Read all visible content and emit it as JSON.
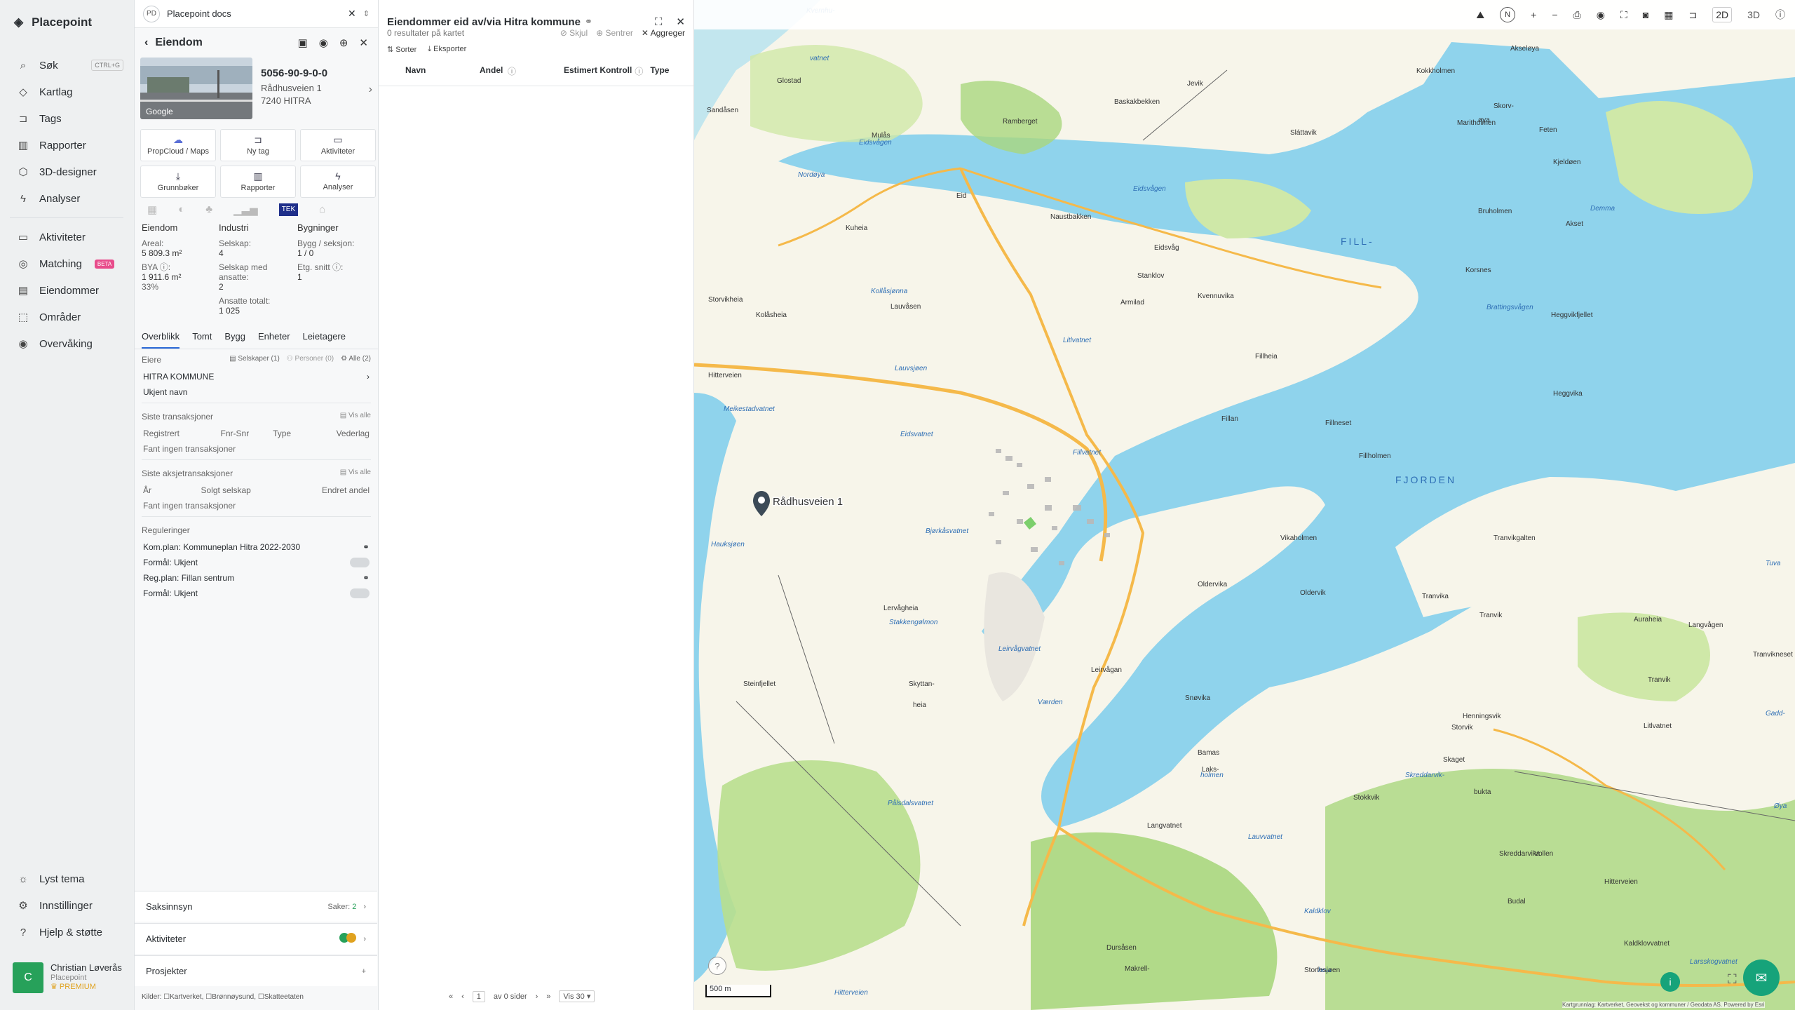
{
  "nav": {
    "brand": "Placepoint",
    "items": [
      {
        "label": "Søk",
        "icon": "search-icon",
        "kbd": "CTRL+G"
      },
      {
        "label": "Kartlag",
        "icon": "layers-icon"
      },
      {
        "label": "Tags",
        "icon": "bookmark-icon"
      },
      {
        "label": "Rapporter",
        "icon": "chart-icon"
      },
      {
        "label": "3D-designer",
        "icon": "cube-icon"
      },
      {
        "label": "Analyser",
        "icon": "bolt-icon"
      }
    ],
    "items2": [
      {
        "label": "Aktiviteter",
        "icon": "chat-icon"
      },
      {
        "label": "Matching",
        "icon": "target-icon",
        "badge": "BETA"
      },
      {
        "label": "Eiendommer",
        "icon": "building-icon"
      },
      {
        "label": "Områder",
        "icon": "area-icon"
      },
      {
        "label": "Overvåking",
        "icon": "bell-icon"
      }
    ],
    "bottom": [
      {
        "label": "Lyst tema",
        "icon": "sun-icon"
      },
      {
        "label": "Innstillinger",
        "icon": "gear-icon"
      },
      {
        "label": "Hjelp & støtte",
        "icon": "help-icon"
      }
    ],
    "user": {
      "initial": "C",
      "name": "Christian Løverås",
      "org": "Placepoint",
      "plan": "PREMIUM"
    }
  },
  "panel1": {
    "tab": {
      "pd": "PD",
      "title": "Placepoint docs"
    },
    "title": "Eiendom",
    "property": {
      "id": "5056-90-9-0-0",
      "street": "Rådhusveien 1",
      "postal": "7240 HITRA",
      "photo_credit": "Google"
    },
    "actions": [
      {
        "label": "PropCloud / Maps",
        "icon": "cloud-icon"
      },
      {
        "label": "Ny tag",
        "icon": "bookmark-icon"
      },
      {
        "label": "Aktiviteter",
        "icon": "chat-icon"
      },
      {
        "label": "Grunnbøker",
        "icon": "download-icon"
      },
      {
        "label": "Rapporter",
        "icon": "chart-icon"
      },
      {
        "label": "Analyser",
        "icon": "bolt-icon"
      }
    ],
    "tek_logo": "TEK",
    "stats": {
      "eiendom": {
        "head": "Eiendom",
        "areal_label": "Areal:",
        "areal": "5 809.3 m²",
        "bya_label": "BYA ⓘ:",
        "bya": "1 911.6 m²",
        "bya_pct": "33%"
      },
      "industri": {
        "head": "Industri",
        "selskap_label": "Selskap:",
        "selskap": "4",
        "ansatte_label": "Selskap med ansatte:",
        "ansatte": "2",
        "totalt_label": "Ansatte totalt:",
        "totalt": "1 025"
      },
      "bygninger": {
        "head": "Bygninger",
        "bygg_label": "Bygg / seksjon:",
        "bygg": "1 / 0",
        "etg_label": "Etg. snitt ⓘ:",
        "etg": "1"
      }
    },
    "tabs": [
      "Overblikk",
      "Tomt",
      "Bygg",
      "Enheter",
      "Leietagere"
    ],
    "eiere": {
      "label": "Eiere",
      "f1": "Selskaper (1)",
      "f2": "Personer (0)",
      "f3": "Alle (2)",
      "owner1": "HITRA KOMMUNE",
      "owner2": "Ukjent navn"
    },
    "trans": {
      "label": "Siste transaksjoner",
      "visalle": "Vis alle",
      "cols": [
        "Registrert",
        "Fnr-Snr",
        "Type",
        "Vederlag"
      ],
      "empty": "Fant ingen transaksjoner"
    },
    "aksje": {
      "label": "Siste aksjetransaksjoner",
      "visalle": "Vis alle",
      "cols": [
        "År",
        "Solgt selskap",
        "Endret andel"
      ],
      "empty": "Fant ingen transaksjoner"
    },
    "reg": {
      "label": "Reguleringer",
      "r1": "Kom.plan: Kommuneplan Hitra 2022-2030",
      "r1f": "Formål: Ukjent",
      "r2": "Reg.plan: Fillan sentrum",
      "r2f": "Formål: Ukjent"
    },
    "saksinnsyn": {
      "label": "Saksinnsyn",
      "saker": "Saker:",
      "count": "2"
    },
    "aktiviteter": {
      "label": "Aktiviteter"
    },
    "prosjekter": {
      "label": "Prosjekter",
      "add": "+"
    },
    "kilder": {
      "label": "Kilder:",
      "k1": "Kartverket,",
      "k2": "Brønnøysund,",
      "k3": "Skatteetaten"
    }
  },
  "panel2": {
    "title": "Eiendommer eid av/via Hitra kommune",
    "results": "0 resultater på kartet",
    "skjul": "Skjul",
    "sentrer": "Sentrer",
    "aggreger": "Aggreger",
    "sorter": "Sorter",
    "eksporter": "Eksporter",
    "cols": [
      "Navn",
      "Andel",
      "Estimert Kontroll",
      "Type"
    ],
    "pager": {
      "page": "1",
      "of": "av 0 sider",
      "vis": "Vis 30"
    }
  },
  "map": {
    "view2d": "2D",
    "view3d": "3D",
    "north": "N",
    "scale": "500 m",
    "marker_label": "Rådhusveien 1",
    "credit": "Kartgrunnlag: Kartverket, Geovekst og kommuner / Geodata AS. Powered by Esri",
    "labels": [
      {
        "t": "Kvernhu-"
      },
      {
        "t": "vatnet"
      },
      {
        "t": "Glostad"
      },
      {
        "t": "Sandåsen"
      },
      {
        "t": "Mulås"
      },
      {
        "t": "Ramberget"
      },
      {
        "t": "Eidsvågen"
      },
      {
        "t": "Nordøya"
      },
      {
        "t": "Jevik"
      },
      {
        "t": "Sláttavik"
      },
      {
        "t": "Kokkholmen"
      },
      {
        "t": "Akseløya"
      },
      {
        "t": "Skorv-"
      },
      {
        "t": "øya"
      },
      {
        "t": "Maritholmen"
      },
      {
        "t": "Feten"
      },
      {
        "t": "Kjeldøen"
      },
      {
        "t": "Eid"
      },
      {
        "t": "Naustbakken"
      },
      {
        "t": "Eidsvågen"
      },
      {
        "t": "Kuheia"
      },
      {
        "t": "Eidsvåg"
      },
      {
        "t": "FILL-"
      },
      {
        "t": "Bruholmen"
      },
      {
        "t": "Demma"
      },
      {
        "t": "Akset"
      },
      {
        "t": "Stanklov"
      },
      {
        "t": "Korsnes"
      },
      {
        "t": "Kollåsjønna"
      },
      {
        "t": "Kvennuvika"
      },
      {
        "t": "Armilad"
      },
      {
        "t": "Brattingsvågen"
      },
      {
        "t": "Storvikheia"
      },
      {
        "t": "Lauvåsen"
      },
      {
        "t": "Heggvikfjellet"
      },
      {
        "t": "Kolåsheia"
      },
      {
        "t": "Heggvika"
      },
      {
        "t": "Litlvatnet"
      },
      {
        "t": "Hitterveien"
      },
      {
        "t": "Fillheia"
      },
      {
        "t": "Lauvsjøen"
      },
      {
        "t": "Meikestadvatnet"
      },
      {
        "t": "Fillan"
      },
      {
        "t": "Fillneset"
      },
      {
        "t": "Eidsvatnet"
      },
      {
        "t": "Fillvatnet"
      },
      {
        "t": "Fillholmen"
      },
      {
        "t": "FJORDEN"
      },
      {
        "t": "Vikaholmen"
      },
      {
        "t": "Tranvikgalten"
      },
      {
        "t": "Hauksjøen"
      },
      {
        "t": "Bjørkåsvatnet"
      },
      {
        "t": "Oldervika"
      },
      {
        "t": "Tuva"
      },
      {
        "t": "Tranvika"
      },
      {
        "t": "Oldervik"
      },
      {
        "t": "Tranvik"
      },
      {
        "t": "Auraheia"
      },
      {
        "t": "Lervågheia"
      },
      {
        "t": "Stakkengølmon"
      },
      {
        "t": "Leirvågvatnet"
      },
      {
        "t": "Langvågen"
      },
      {
        "t": "Leirvågan"
      },
      {
        "t": "Tranvik"
      },
      {
        "t": "Tranvikneset"
      },
      {
        "t": "Steinfjellet"
      },
      {
        "t": "Skyttan-"
      },
      {
        "t": "heia"
      },
      {
        "t": "Snøvika"
      },
      {
        "t": "Værden"
      },
      {
        "t": "Gadd-"
      },
      {
        "t": "Litlvatnet"
      },
      {
        "t": "Henningsvik"
      },
      {
        "t": "Storvik"
      },
      {
        "t": "Skaget"
      },
      {
        "t": "Bamas"
      },
      {
        "t": "Laks-"
      },
      {
        "t": "holmen"
      },
      {
        "t": "Skreddarvik-"
      },
      {
        "t": "bukta"
      },
      {
        "t": "Stokkvik"
      },
      {
        "t": "Øya"
      },
      {
        "t": "Langvatnet"
      },
      {
        "t": "Vollen"
      },
      {
        "t": "Lauvvatnet"
      },
      {
        "t": "Skreddarvika"
      },
      {
        "t": "Hitterveien"
      },
      {
        "t": "Budal"
      },
      {
        "t": "Kaldklov"
      },
      {
        "t": "Kaldklovvatnet"
      },
      {
        "t": "Dursåsen"
      },
      {
        "t": "Makrell-"
      },
      {
        "t": "heia"
      },
      {
        "t": "Storfesjøen"
      },
      {
        "t": "Hitterveien"
      },
      {
        "t": "Larsskogvatnet"
      },
      {
        "t": "Pålsdalsvatnet"
      },
      {
        "t": "Baskakbekken"
      }
    ]
  }
}
